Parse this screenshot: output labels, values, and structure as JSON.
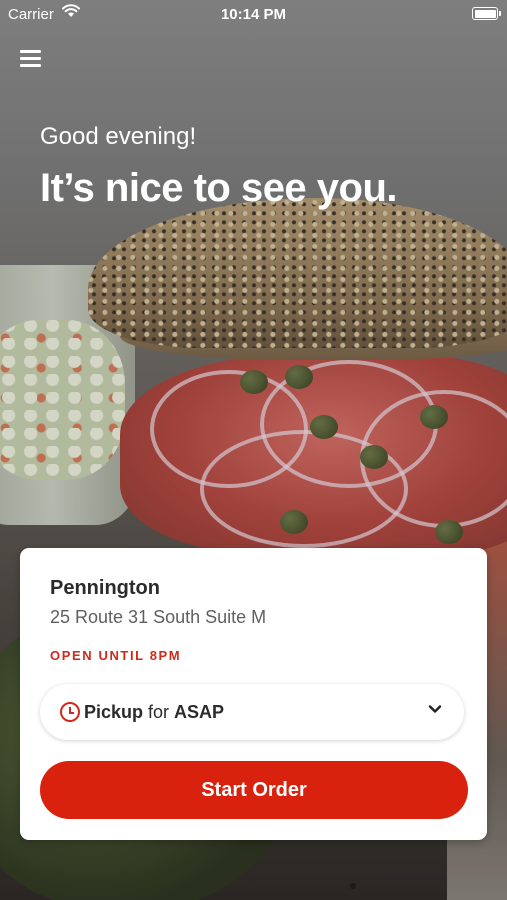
{
  "status_bar": {
    "carrier": "Carrier",
    "time": "10:14 PM",
    "battery_level": 1.0,
    "icons": [
      "wifi-icon",
      "battery-icon"
    ]
  },
  "header": {
    "menu_icon": "hamburger-menu-icon",
    "greeting": "Good evening!",
    "headline": "It’s nice to see you."
  },
  "location_card": {
    "name": "Pennington",
    "address": "25 Route 31 South Suite M",
    "hours": "OPEN UNTIL 8PM",
    "order_mode": {
      "icon": "clock-icon",
      "mode": "Pickup",
      "connector": " for ",
      "when": "ASAP",
      "dropdown_icon": "chevron-down-icon"
    },
    "start_button": "Start Order"
  },
  "colors": {
    "accent": "#d9220e",
    "hours_text": "#d02a1c",
    "card_bg": "#ffffff"
  }
}
